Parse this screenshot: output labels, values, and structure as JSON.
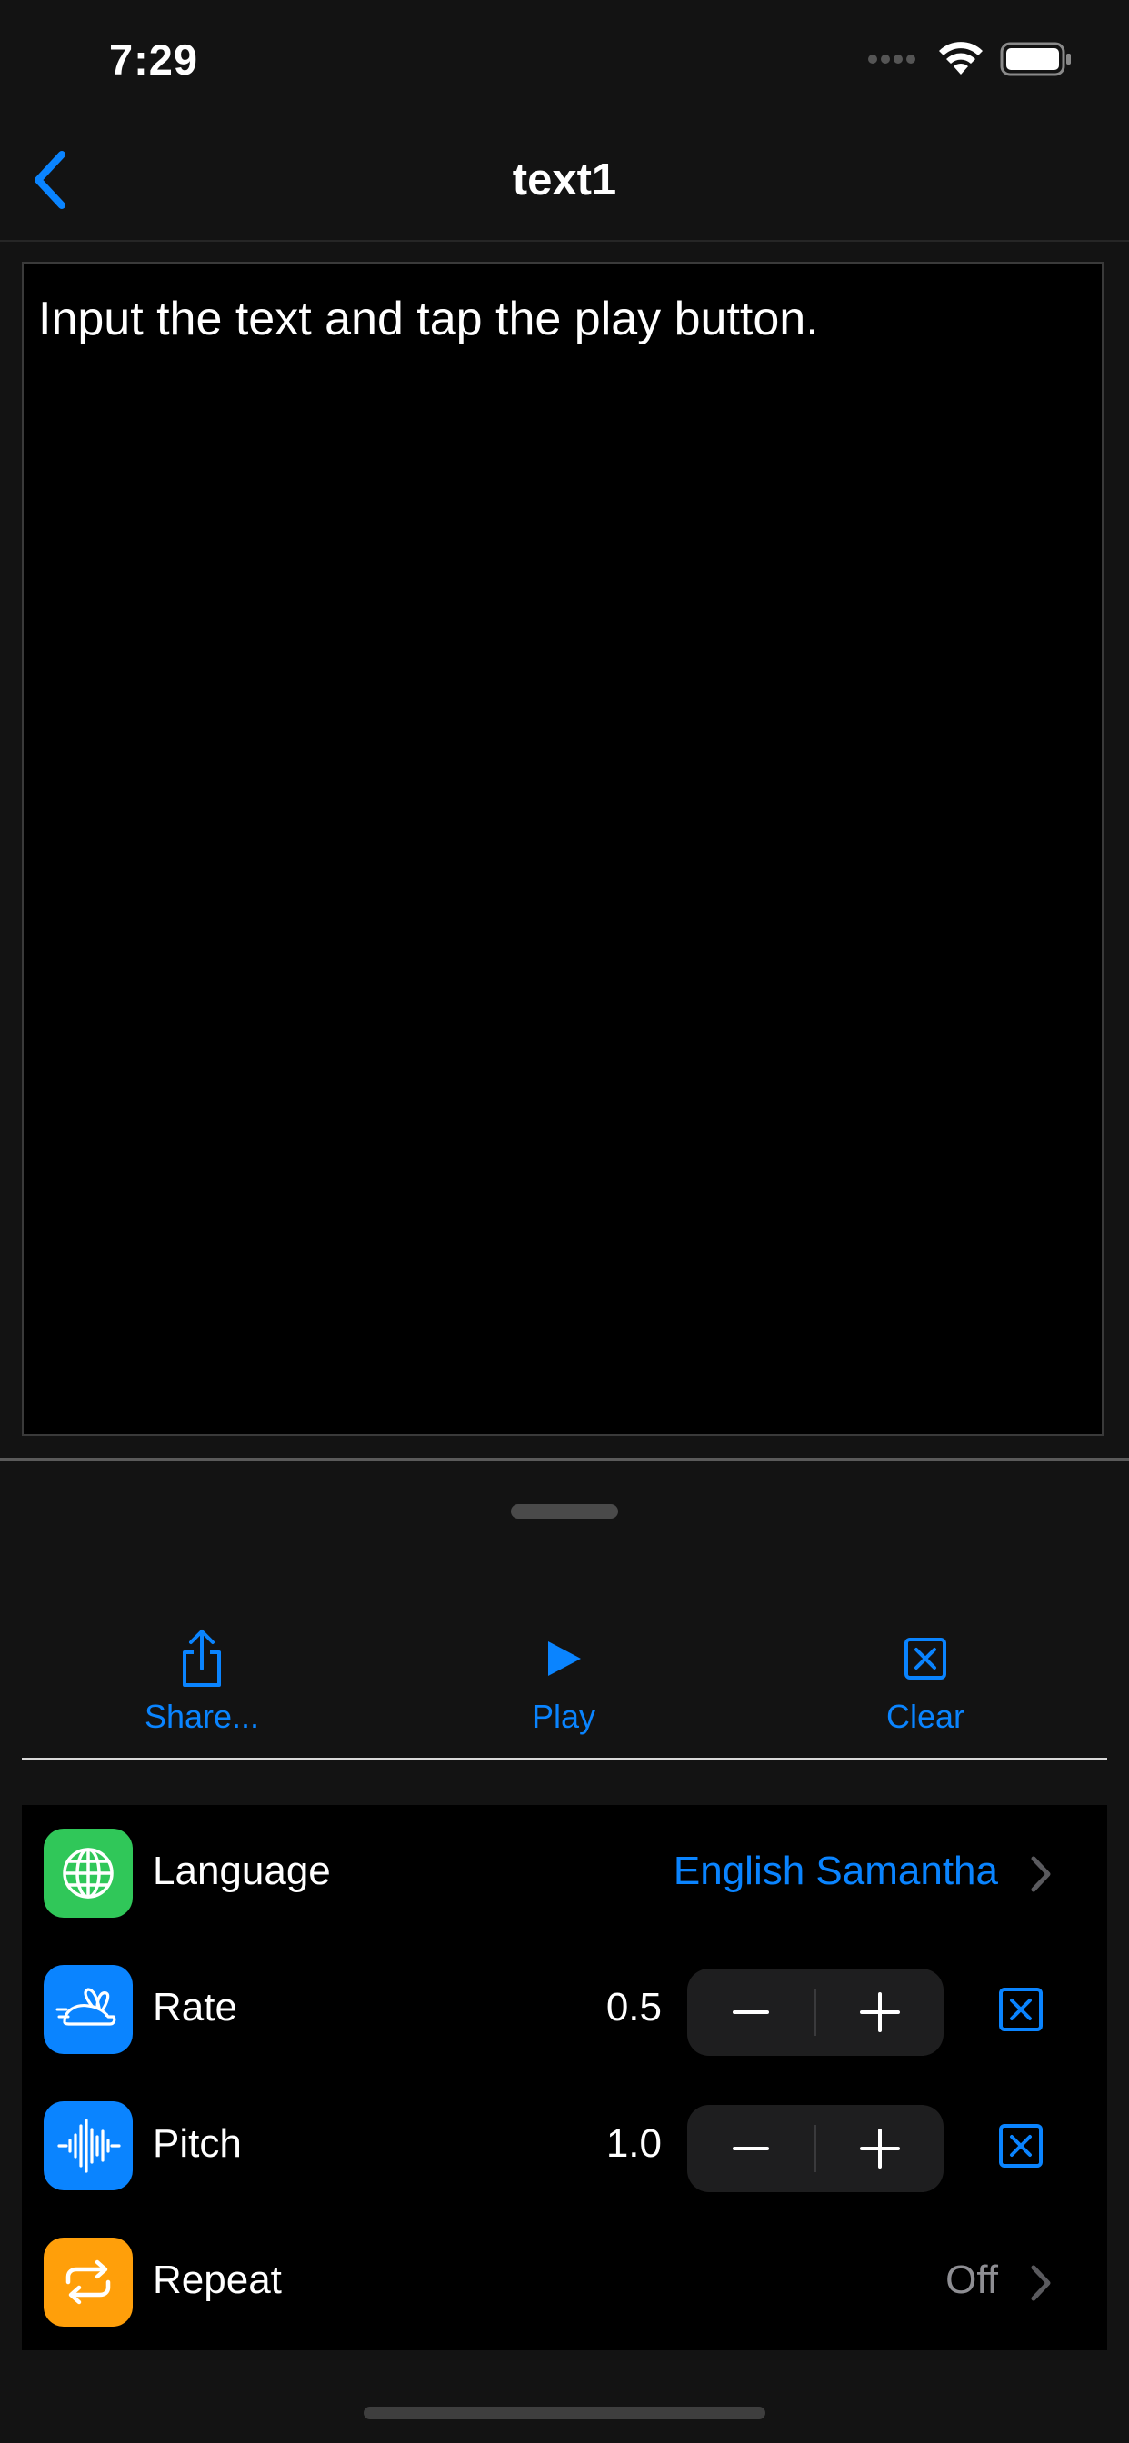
{
  "status_bar": {
    "time": "7:29"
  },
  "nav": {
    "title": "text1",
    "back_icon": "chevron-left-icon"
  },
  "editor": {
    "text": "Input the text and tap the play button."
  },
  "toolbar": {
    "share_label": "Share...",
    "play_label": "Play",
    "clear_label": "Clear"
  },
  "settings": {
    "language": {
      "label": "Language",
      "value": "English Samantha",
      "icon": "globe-icon",
      "icon_color": "#30c759"
    },
    "rate": {
      "label": "Rate",
      "value": "0.5",
      "icon": "rabbit-icon",
      "icon_color": "#0a84ff"
    },
    "pitch": {
      "label": "Pitch",
      "value": "1.0",
      "icon": "waveform-icon",
      "icon_color": "#0a84ff"
    },
    "repeat": {
      "label": "Repeat",
      "value": "Off",
      "icon": "repeat-icon",
      "icon_color": "#ff9f0a"
    }
  },
  "colors": {
    "accent": "#0a84ff",
    "background": "#131313"
  }
}
